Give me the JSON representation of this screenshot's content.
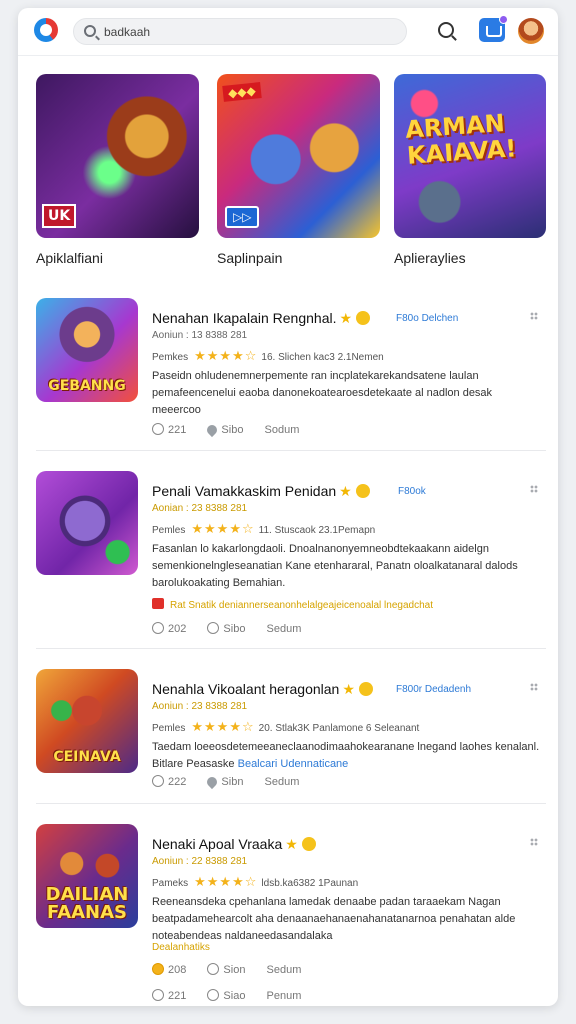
{
  "header": {
    "search_value": "badkaah",
    "logo_icon": "app-logo-icon",
    "search_icon": "search-icon",
    "upload_icon": "upload-icon",
    "avatar_icon": "user-avatar"
  },
  "featured": [
    {
      "label": "Apiklalfiani",
      "thumb_text": "UK"
    },
    {
      "label": "Saplinpain",
      "thumb_text": ""
    },
    {
      "label": "Aplieraylies",
      "thumb_text": "ARMAN KAIAVA!"
    }
  ],
  "items": [
    {
      "title": "Nenahan Ikapalain Rengnhal.",
      "tag": "F80o Delchen",
      "meta": "Aoniun : 13 8388 281",
      "rating_label": "Pemkes",
      "stars": "★★★★☆",
      "rating_text": "16. Slichen kac3 2.1Nemen",
      "desc": "Paseidn ohludenemnerpemente ran incplatekarekandsatene laulan pemafeencenelui eaoba danonekoatearoesdetekaate al nadlon desak meeercoo",
      "thumb_caption": "GEBANNG",
      "action1": "221",
      "action2": "Sibo",
      "action3": "Sodum"
    },
    {
      "title": "Penali Vamakkaskim Penidan",
      "tag": "F80ok",
      "meta": "Aonian : 23 8388 281",
      "rating_label": "Pemles",
      "stars": "★★★★☆",
      "rating_text": "11. Stuscaok 23.1Pemapn",
      "desc": "Fasanlan lo kakarlongdaoli. Dnoalnanonyemneobdtekaakann aidelgn semenkionelngleseanatian Kane etenhararal, Panatn oloalkatanaral dalods barolukoakating Bemahian.",
      "warn": "Rat Snatik deniannerseanonhelalgeajeicenoalal lnegadchat",
      "thumb_caption": "",
      "action1": "202",
      "action2": "Sibo",
      "action3": "Sedum"
    },
    {
      "title": "Nenahla Vikoalant heragonlan",
      "tag": "F800r Dedadenh",
      "meta": "Aoniun : 23 8388 281",
      "rating_label": "Pemles",
      "stars": "★★★★☆",
      "rating_text": "20. Stlak3K Panlamone 6 Seleanant",
      "desc": "Taedam loeeosdetemeeaneclaanodimaahokearanane lnegand laohes kenalanl. Bitlare Peasaske",
      "desc_link": "Bealcari Udennaticane",
      "thumb_caption": "CEINAVA",
      "action1": "222",
      "action2": "Sibn",
      "action3": "Sedum"
    },
    {
      "title": "Nenaki Apoal Vraaka",
      "tag": "",
      "meta": "Aoniun : 22 8388 281",
      "rating_label": "Pameks",
      "stars": "★★★★☆",
      "rating_text": "ldsb.ka6382 1Paunan",
      "desc": "Reeneansdeka cpehanlana lamedak denaabe padan taraaekam Nagan beatpadamehearcolt aha denaanaehanaenahanatanarnoa penahatan alde noteabendeas naldaneedasandalaka",
      "sub_tag": "Dealanhatiks",
      "thumb_caption": "DAILIAN FAANAS",
      "action1": "208",
      "action2": "Sion",
      "action3": "Sedum",
      "action4": "221",
      "action5": "Siao",
      "action6": "Penum"
    }
  ]
}
